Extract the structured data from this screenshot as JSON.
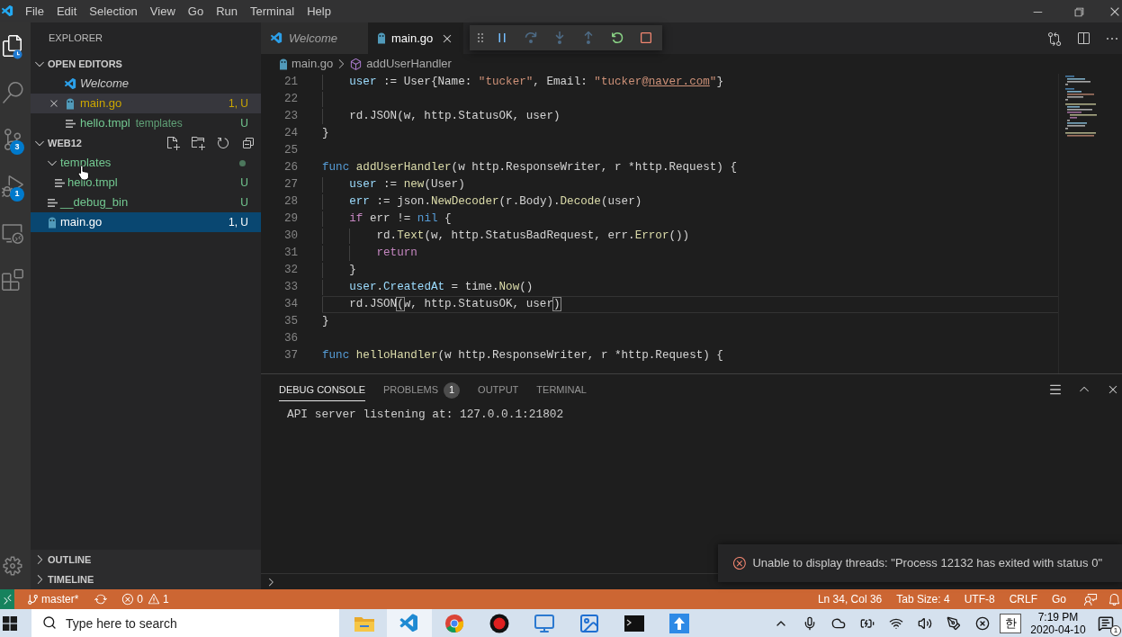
{
  "menu_bar": {
    "items": [
      "File",
      "Edit",
      "Selection",
      "View",
      "Go",
      "Run",
      "Terminal",
      "Help"
    ]
  },
  "activity_bar": {
    "items": [
      {
        "selected": true
      },
      {
        "selected": false
      },
      {
        "selected": false,
        "badge": "3"
      },
      {
        "selected": false,
        "badge": "1"
      },
      {
        "selected": false
      },
      {
        "selected": false
      }
    ]
  },
  "sidebar": {
    "title": "EXPLORER",
    "open_editors": {
      "title": "OPEN EDITORS",
      "expanded": true,
      "items": [
        {
          "name": "Welcome",
          "kind": "welcome",
          "preview": true,
          "selected": false
        },
        {
          "name": "main.go",
          "kind": "go",
          "preview": false,
          "selected": true,
          "color": "#cca700",
          "badge": "1, U"
        },
        {
          "name": "hello.tmpl",
          "kind": "text",
          "preview": false,
          "selected": false,
          "color": "#73c991",
          "description": "templates",
          "badge": "U"
        }
      ]
    },
    "folder": {
      "title": "WEB12",
      "expanded": true,
      "tree": [
        {
          "name": "templates",
          "kind": "folder",
          "expanded": true,
          "selected": false,
          "color": "#73c991",
          "children": [
            {
              "name": "hello.tmpl",
              "kind": "text",
              "selected": false,
              "color": "#73c991",
              "badge": "U"
            }
          ]
        },
        {
          "name": "__debug_bin",
          "kind": "text",
          "selected": false,
          "color": "#73c991",
          "badge": "U"
        },
        {
          "name": "main.go",
          "kind": "go",
          "selected": true,
          "badge": "1, U"
        }
      ]
    },
    "collapsed_sections": [
      {
        "title": "OUTLINE",
        "expanded": false
      },
      {
        "title": "TIMELINE",
        "expanded": false
      }
    ]
  },
  "editor": {
    "tabs": [
      {
        "label": "Welcome",
        "kind": "welcome",
        "preview": true,
        "selected": false
      },
      {
        "label": "main.go",
        "kind": "go",
        "preview": false,
        "selected": true
      }
    ],
    "debug_toolbar": {
      "buttons": [
        {
          "disabled": false
        },
        {
          "disabled": true
        },
        {
          "disabled": true
        },
        {
          "disabled": true
        },
        {
          "disabled": false
        },
        {
          "disabled": false
        }
      ]
    },
    "breadcrumbs": [
      {
        "label": "main.go",
        "kind": "go"
      },
      {
        "label": "addUserHandler",
        "kind": "method"
      }
    ],
    "lines": [
      {
        "number": "21",
        "current": false,
        "tokens": [
          {
            "text": "    user",
            "kind": "variable"
          },
          {
            "text": " := User{Name: ",
            "kind": "plain"
          },
          {
            "text": "\"tucker\"",
            "kind": "string"
          },
          {
            "text": ", Email: ",
            "kind": "plain"
          },
          {
            "text": "\"tucker@",
            "kind": "string"
          },
          {
            "text": "naver.com",
            "kind": "link"
          },
          {
            "text": "\"",
            "kind": "string"
          },
          {
            "text": "}",
            "kind": "plain"
          }
        ]
      },
      {
        "number": "22",
        "current": false
      },
      {
        "number": "23",
        "current": false,
        "tokens": [
          {
            "text": "    rd.JSON(w, http.StatusOK, user)",
            "kind": "plain"
          }
        ]
      },
      {
        "number": "24",
        "current": false,
        "tokens": [
          {
            "text": "}",
            "kind": "plain"
          }
        ]
      },
      {
        "number": "25",
        "current": false
      },
      {
        "number": "26",
        "current": false,
        "tokens": [
          {
            "text": "func ",
            "kind": "keyword"
          },
          {
            "text": "addUserHandler",
            "kind": "function"
          },
          {
            "text": "(w http.ResponseWriter, r *http.Request) {",
            "kind": "plain"
          }
        ]
      },
      {
        "number": "27",
        "current": false,
        "tokens": [
          {
            "text": "    user",
            "kind": "variable"
          },
          {
            "text": " := ",
            "kind": "plain"
          },
          {
            "text": "new",
            "kind": "function"
          },
          {
            "text": "(User)",
            "kind": "plain"
          }
        ]
      },
      {
        "number": "28",
        "current": false,
        "tokens": [
          {
            "text": "    err",
            "kind": "variable"
          },
          {
            "text": " := json.",
            "kind": "plain"
          },
          {
            "text": "NewDecoder",
            "kind": "function"
          },
          {
            "text": "(r.Body).",
            "kind": "plain"
          },
          {
            "text": "Decode",
            "kind": "function"
          },
          {
            "text": "(user)",
            "kind": "plain"
          }
        ]
      },
      {
        "number": "29",
        "current": false,
        "tokens": [
          {
            "text": "    if",
            "kind": "control"
          },
          {
            "text": " err != ",
            "kind": "plain"
          },
          {
            "text": "nil",
            "kind": "keyword"
          },
          {
            "text": " {",
            "kind": "plain"
          }
        ]
      },
      {
        "number": "30",
        "current": false,
        "tokens": [
          {
            "text": "        rd.",
            "kind": "plain"
          },
          {
            "text": "Text",
            "kind": "function"
          },
          {
            "text": "(w, http.StatusBadRequest, err.",
            "kind": "plain"
          },
          {
            "text": "Error",
            "kind": "function"
          },
          {
            "text": "())",
            "kind": "plain"
          }
        ]
      },
      {
        "number": "31",
        "current": false,
        "tokens": [
          {
            "text": "        return",
            "kind": "control"
          }
        ]
      },
      {
        "number": "32",
        "current": false,
        "tokens": [
          {
            "text": "    }",
            "kind": "plain"
          }
        ]
      },
      {
        "number": "33",
        "current": false,
        "tokens": [
          {
            "text": "    user",
            "kind": "variable"
          },
          {
            "text": ".",
            "kind": "plain"
          },
          {
            "text": "CreatedAt",
            "kind": "variable"
          },
          {
            "text": " = time.",
            "kind": "plain"
          },
          {
            "text": "Now",
            "kind": "function"
          },
          {
            "text": "()",
            "kind": "plain"
          }
        ]
      },
      {
        "number": "34",
        "current": true,
        "tokens": [
          {
            "text": "    rd.JSON",
            "kind": "plain"
          },
          {
            "text": "(",
            "kind": "bracket"
          },
          {
            "text": "w, http.StatusOK, user",
            "kind": "plain"
          },
          {
            "text": ")",
            "kind": "bracket"
          }
        ]
      },
      {
        "number": "35",
        "current": false,
        "tokens": [
          {
            "text": "}",
            "kind": "plain"
          }
        ]
      },
      {
        "number": "36",
        "current": false
      },
      {
        "number": "37",
        "current": false,
        "tokens": [
          {
            "text": "func ",
            "kind": "keyword"
          },
          {
            "text": "helloHandler",
            "kind": "function"
          },
          {
            "text": "(w http.ResponseWriter, r *http.Request) {",
            "kind": "plain"
          }
        ]
      }
    ]
  },
  "panel": {
    "tabs": [
      {
        "label": "DEBUG CONSOLE",
        "selected": true
      },
      {
        "label": "PROBLEMS",
        "selected": false,
        "badge": "1"
      },
      {
        "label": "OUTPUT",
        "selected": false
      },
      {
        "label": "TERMINAL",
        "selected": false
      }
    ],
    "console_lines": [
      "API server listening at: 127.0.0.1:21802"
    ]
  },
  "notification": {
    "kind": "error",
    "message": "Unable to display threads: \"Process 12132 has exited with status 0\""
  },
  "status_bar": {
    "debugging": true,
    "branch": "master*",
    "errors": "0",
    "warnings": "1",
    "items": [
      "Ln 34, Col 36",
      "Tab Size: 4",
      "UTF-8",
      "CRLF",
      "Go"
    ]
  },
  "taskbar": {
    "search": {
      "placeholder": "Type here to search"
    },
    "apps": [
      {
        "selected": false
      },
      {
        "selected": true
      },
      {
        "selected": false
      },
      {
        "selected": false
      },
      {
        "selected": false
      },
      {
        "selected": false
      },
      {
        "selected": false
      },
      {
        "selected": false
      }
    ],
    "input_method": "한",
    "time": "7:19 PM",
    "date": "2020-04-10",
    "notification_count": "1"
  }
}
